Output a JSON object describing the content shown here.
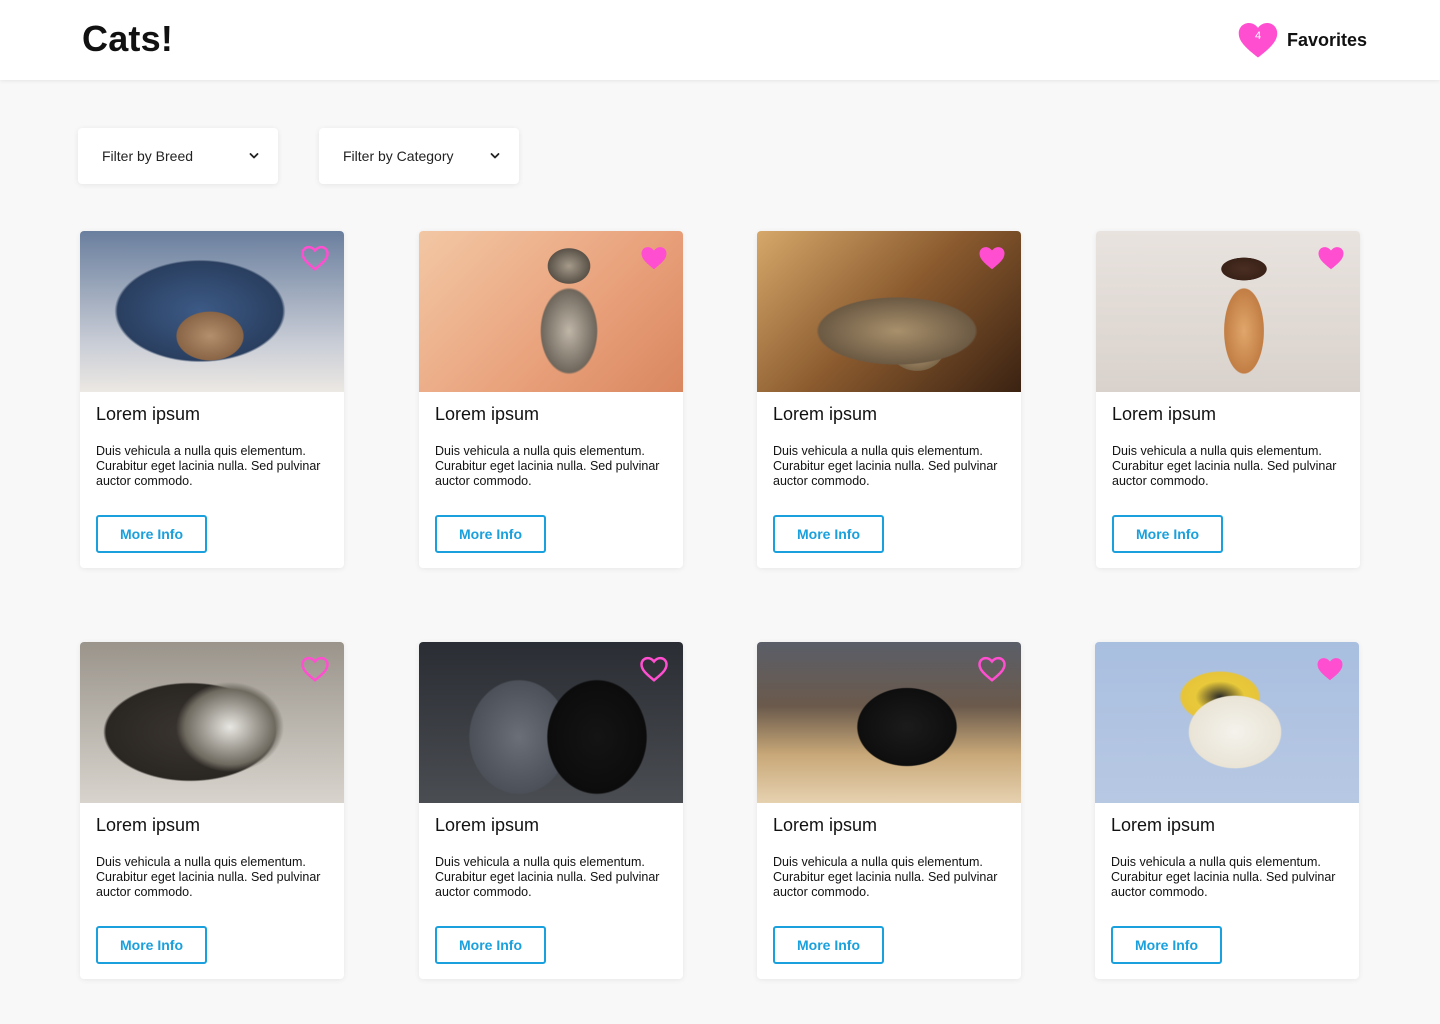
{
  "header": {
    "logo": "Cats!",
    "favorites_label": "Favorites",
    "favorites_count": "4"
  },
  "filters": {
    "breed_label": "Filter by Breed",
    "category_label": "Filter by Category"
  },
  "colors": {
    "accent_pink": "#ff4fd0",
    "button_blue": "#1aa0dc"
  },
  "cards": [
    {
      "title": "Lorem ipsum",
      "description": "Duis vehicula a nulla quis elementum. Curabitur eget lacinia nulla. Sed pulvinar auctor commodo.",
      "button": "More Info",
      "favorited": false
    },
    {
      "title": "Lorem ipsum",
      "description": "Duis vehicula a nulla quis elementum. Curabitur eget lacinia nulla. Sed pulvinar auctor commodo.",
      "button": "More Info",
      "favorited": true
    },
    {
      "title": "Lorem ipsum",
      "description": "Duis vehicula a nulla quis elementum. Curabitur eget lacinia nulla. Sed pulvinar auctor commodo.",
      "button": "More Info",
      "favorited": true
    },
    {
      "title": "Lorem ipsum",
      "description": "Duis vehicula a nulla quis elementum. Curabitur eget lacinia nulla. Sed pulvinar auctor commodo.",
      "button": "More Info",
      "favorited": true
    },
    {
      "title": "Lorem ipsum",
      "description": "Duis vehicula a nulla quis elementum. Curabitur eget lacinia nulla. Sed pulvinar auctor commodo.",
      "button": "More Info",
      "favorited": false
    },
    {
      "title": "Lorem ipsum",
      "description": "Duis vehicula a nulla quis elementum. Curabitur eget lacinia nulla. Sed pulvinar auctor commodo.",
      "button": "More Info",
      "favorited": false
    },
    {
      "title": "Lorem ipsum",
      "description": "Duis vehicula a nulla quis elementum. Curabitur eget lacinia nulla. Sed pulvinar auctor commodo.",
      "button": "More Info",
      "favorited": false
    },
    {
      "title": "Lorem ipsum",
      "description": "Duis vehicula a nulla quis elementum. Curabitur eget lacinia nulla. Sed pulvinar auctor commodo.",
      "button": "More Info",
      "favorited": true
    }
  ]
}
